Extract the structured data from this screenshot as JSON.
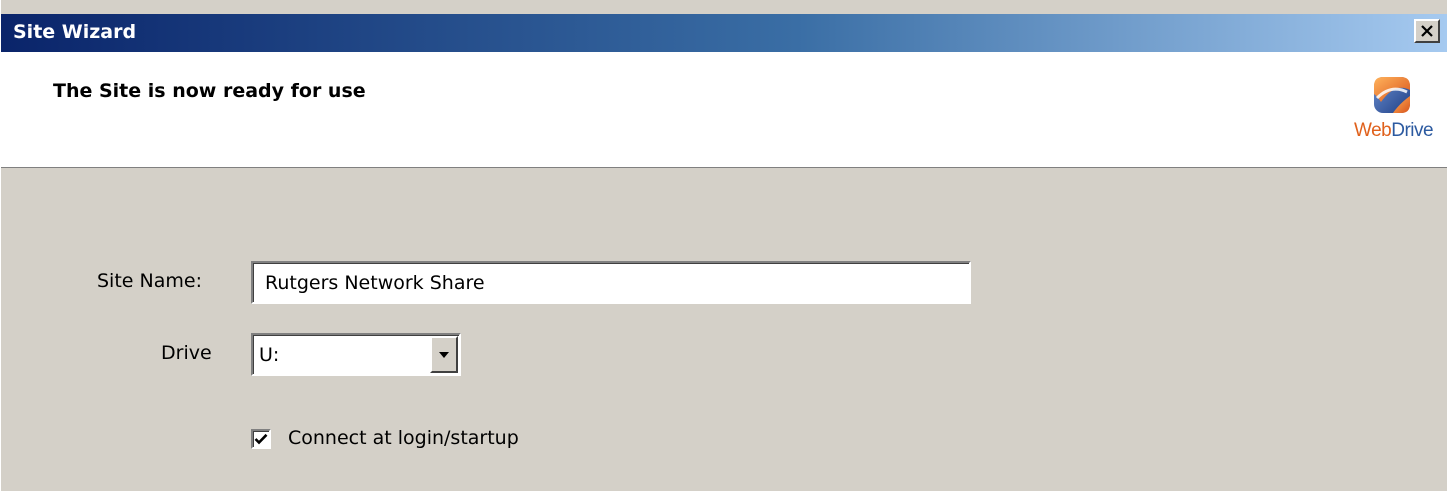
{
  "window": {
    "title": "Site Wizard",
    "close_symbol": "×"
  },
  "header": {
    "title": "The Site is now ready for use",
    "logo": {
      "text_part1": "Web",
      "text_part2": "Drive",
      "icon": "webdrive-logo-icon"
    }
  },
  "form": {
    "site_name_label": "Site Name:",
    "site_name_value": "Rutgers Network Share",
    "drive_label": "Drive",
    "drive_value": "U:",
    "connect_label": "Connect at login/startup",
    "connect_checked": true
  },
  "colors": {
    "title_gradient_start": "#0a246a",
    "title_gradient_end": "#a6caf0",
    "face": "#d4d0c8",
    "logo_orange": "#e0611c",
    "logo_blue": "#2c5aa0"
  }
}
